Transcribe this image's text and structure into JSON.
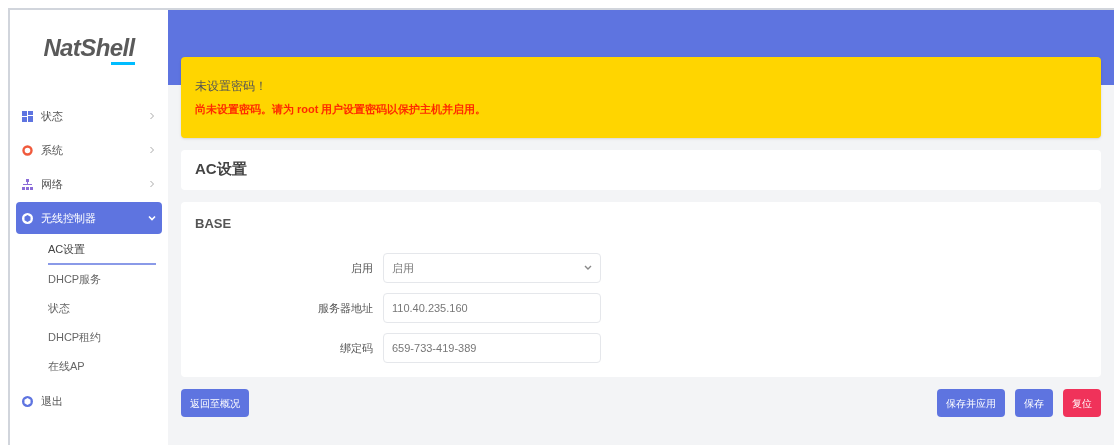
{
  "logo": {
    "brand": "NatShell"
  },
  "sidebar": {
    "items": [
      {
        "label": "状态",
        "expanded": false,
        "selected": false
      },
      {
        "label": "系统",
        "expanded": false,
        "selected": false
      },
      {
        "label": "网络",
        "expanded": false,
        "selected": false
      },
      {
        "label": "无线控制器",
        "expanded": true,
        "selected": true,
        "children": [
          {
            "label": "AC设置",
            "selected": true
          },
          {
            "label": "DHCP服务",
            "selected": false
          },
          {
            "label": "状态",
            "selected": false
          },
          {
            "label": "DHCP租约",
            "selected": false
          },
          {
            "label": "在线AP",
            "selected": false
          }
        ]
      },
      {
        "label": "退出",
        "selected": false
      }
    ]
  },
  "alert": {
    "title": "未设置密码！",
    "message": "尚未设置密码。请为 root 用户设置密码以保护主机并启用。"
  },
  "page_title": "AC设置",
  "section": {
    "title": "BASE",
    "fields": [
      {
        "kind": "select",
        "label": "启用",
        "value": "启用"
      },
      {
        "kind": "input",
        "label": "服务器地址",
        "value": "110.40.235.160"
      },
      {
        "kind": "input",
        "label": "绑定码",
        "value": "659-733-419-389"
      }
    ]
  },
  "left_buttons": [
    {
      "label": "返回至概况",
      "kind": "primary"
    }
  ],
  "right_buttons": [
    {
      "label": "保存并应用",
      "kind": "primary"
    },
    {
      "label": "保存",
      "kind": "primary"
    },
    {
      "label": "复位",
      "kind": "danger"
    }
  ]
}
